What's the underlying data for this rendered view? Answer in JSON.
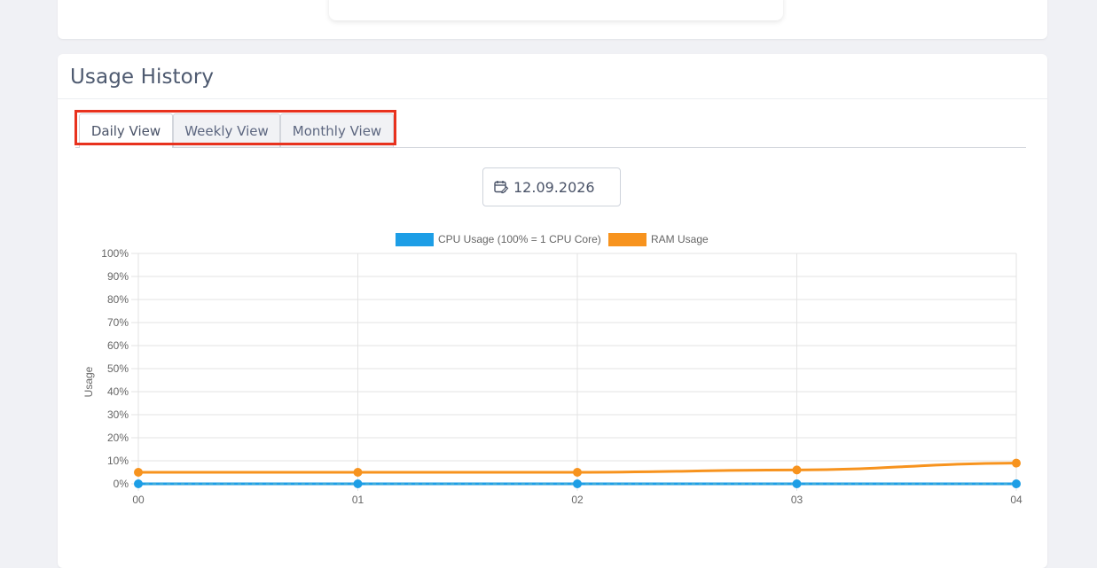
{
  "usage_section": {
    "title": "Usage History",
    "tabs": [
      {
        "label": "Daily View",
        "active": true
      },
      {
        "label": "Weekly View",
        "active": false
      },
      {
        "label": "Monthly View",
        "active": false
      }
    ],
    "date_picker": {
      "value": "12.09.2026",
      "icon": "calendar-edit-icon"
    }
  },
  "colors": {
    "cpu": "#1d9ee6",
    "ram": "#f7931e",
    "tab_highlight": "#e8321e"
  },
  "chart_data": {
    "type": "line",
    "categories": [
      "00",
      "01",
      "02",
      "03",
      "04"
    ],
    "series": [
      {
        "name": "CPU Usage (100% = 1 CPU Core)",
        "values": [
          0,
          0,
          0,
          0,
          0
        ]
      },
      {
        "name": "RAM Usage",
        "values": [
          5,
          5,
          5,
          6,
          9
        ]
      }
    ],
    "ylabel": "Usage",
    "xlabel": "",
    "ylim": [
      0,
      100
    ],
    "yticks": [
      "0%",
      "10%",
      "20%",
      "30%",
      "40%",
      "50%",
      "60%",
      "70%",
      "80%",
      "90%",
      "100%"
    ],
    "legend": "top-center",
    "grid": true
  }
}
